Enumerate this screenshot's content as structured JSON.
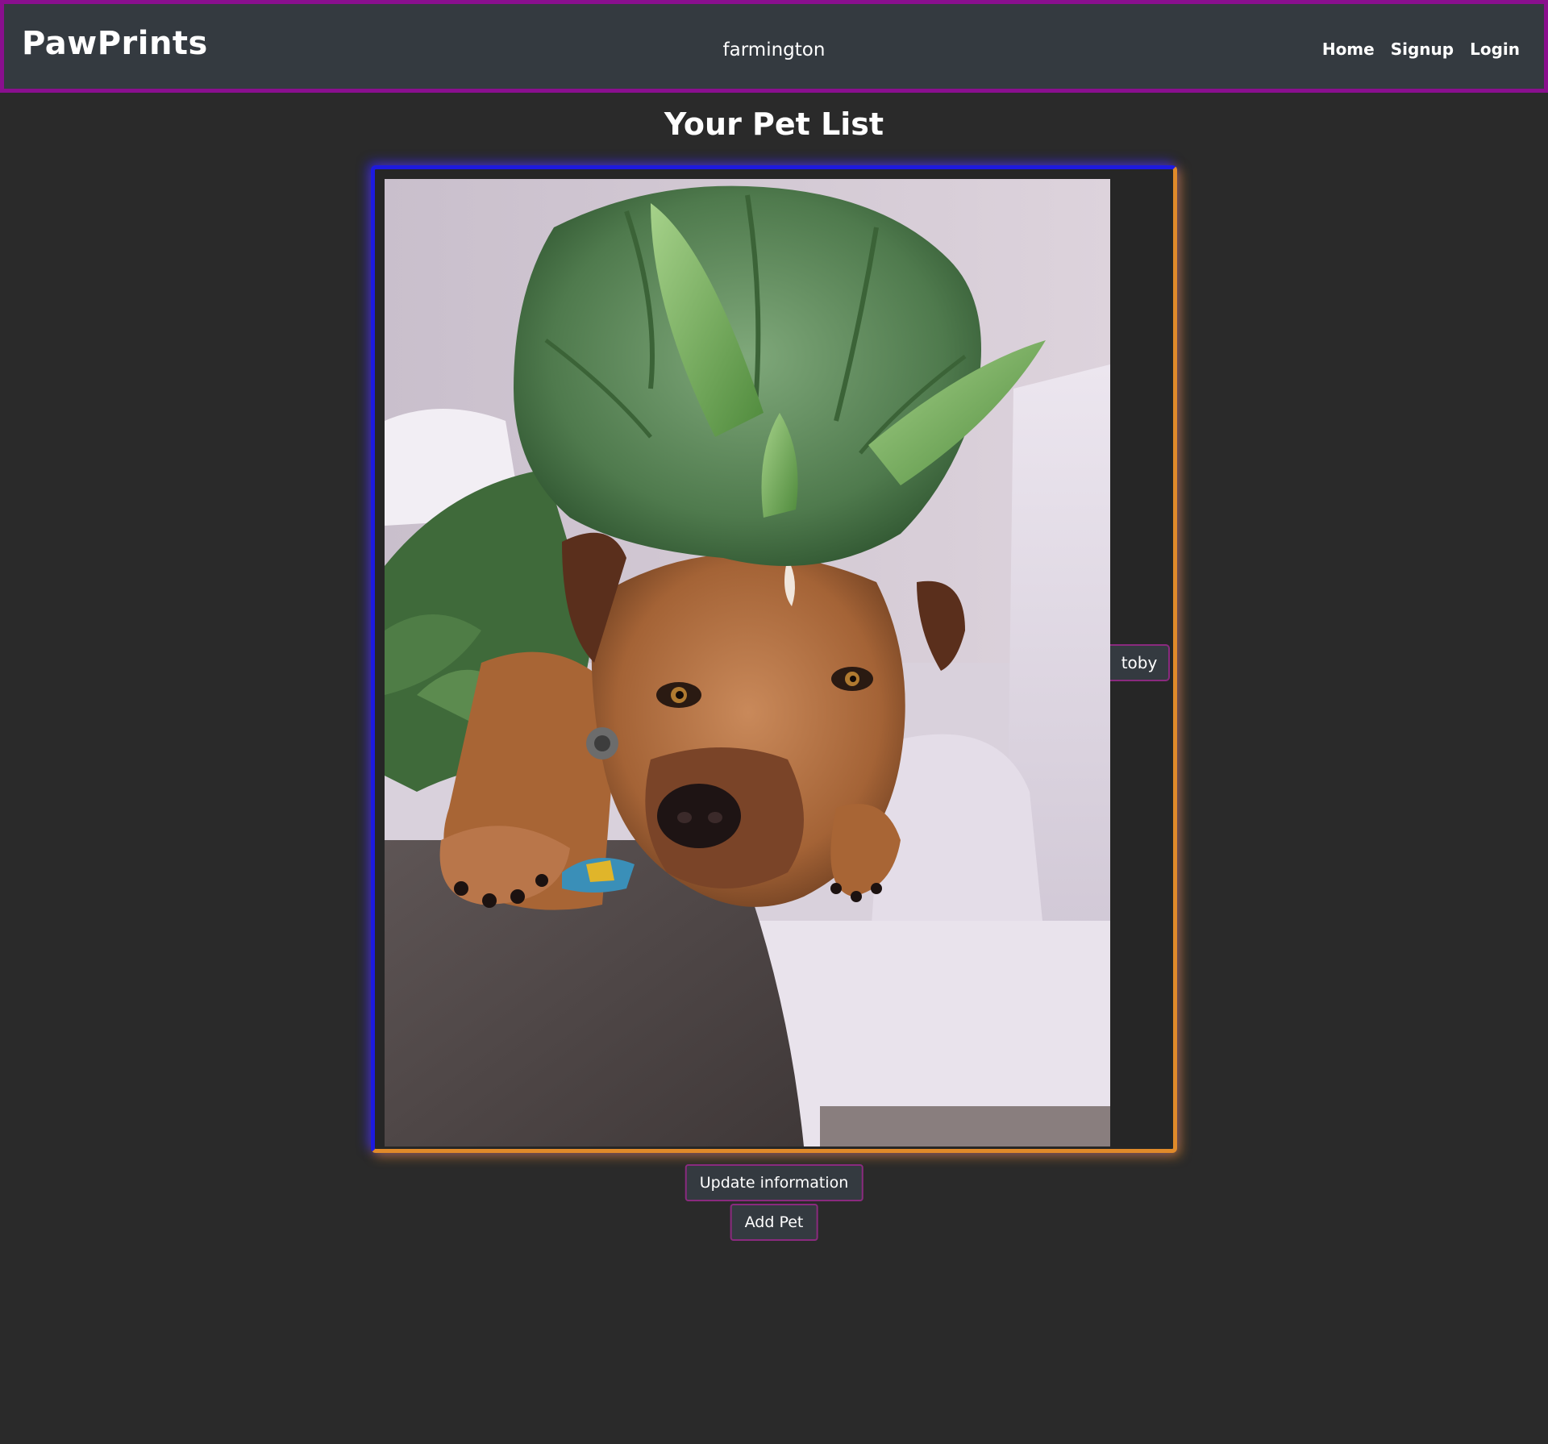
{
  "navbar": {
    "brand": "PawPrints",
    "username": "farmington",
    "links": [
      "Home",
      "Signup",
      "Login"
    ]
  },
  "page": {
    "title": "Your Pet List"
  },
  "pets": [
    {
      "name": "toby",
      "photo_alt": "toby"
    }
  ],
  "actions": {
    "update_label": "Update information",
    "add_pet_label": "Add Pet"
  },
  "colors": {
    "background": "#2a2a2a",
    "navbar": "#343a40",
    "navbar_border": "#8a0f8e",
    "card_glow_top_left": "#1d1adf",
    "card_glow_bottom_right": "#e08a2a",
    "button_border": "#8a2a7e"
  }
}
